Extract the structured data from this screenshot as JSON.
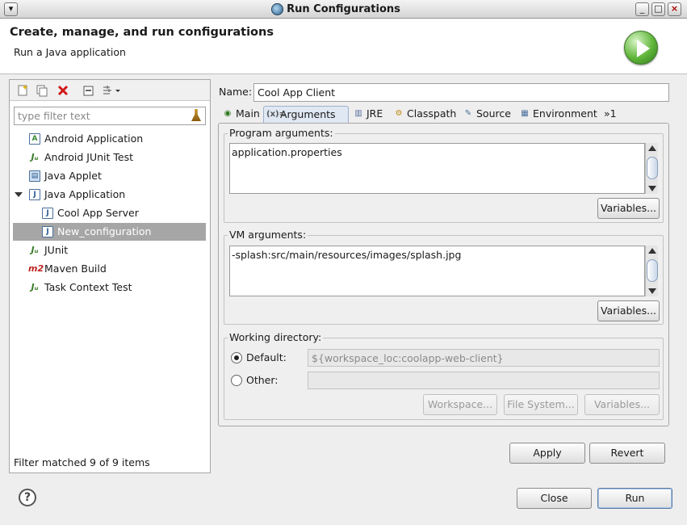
{
  "window": {
    "title": "Run Configurations",
    "menu_icon": "chevron-down-icon",
    "minimize": "_",
    "maximize": "□",
    "close": "×"
  },
  "header": {
    "title": "Create, manage, and run configurations",
    "subtitle": "Run a Java application",
    "icon": "run-icon"
  },
  "left": {
    "toolbar": [
      "new-config-icon",
      "duplicate-icon",
      "delete-icon",
      "collapse-all-icon",
      "filter-icon"
    ],
    "filter_placeholder": "type filter text",
    "tree": [
      {
        "label": "Android Application",
        "icon": "android-app-icon",
        "level": 0
      },
      {
        "label": "Android JUnit Test",
        "icon": "junit-icon",
        "level": 0
      },
      {
        "label": "Java Applet",
        "icon": "java-applet-icon",
        "level": 0
      },
      {
        "label": "Java Application",
        "icon": "java-app-icon",
        "level": 0,
        "expanded": true
      },
      {
        "label": "Cool App Server",
        "icon": "java-app-icon",
        "level": 1
      },
      {
        "label": "New_configuration",
        "icon": "java-app-icon",
        "level": 1,
        "selected": true
      },
      {
        "label": "JUnit",
        "icon": "junit-icon",
        "level": 0
      },
      {
        "label": "Maven Build",
        "icon": "maven-icon",
        "level": 0
      },
      {
        "label": "Task Context Test",
        "icon": "task-junit-icon",
        "level": 0
      }
    ],
    "filter_status": "Filter matched 9 of 9 items"
  },
  "name": {
    "label": "Name:",
    "value": "Cool App Client"
  },
  "tabs": [
    {
      "label": "Main",
      "icon": "main-tab-icon"
    },
    {
      "label": "Arguments",
      "icon": "arguments-tab-icon",
      "active": true
    },
    {
      "label": "JRE",
      "icon": "jre-tab-icon"
    },
    {
      "label": "Classpath",
      "icon": "classpath-tab-icon"
    },
    {
      "label": "Source",
      "icon": "source-tab-icon"
    },
    {
      "label": "Environment",
      "icon": "environment-tab-icon"
    },
    {
      "label": "»1",
      "icon": "more-tabs-icon"
    }
  ],
  "program_args": {
    "label": "Program arguments:",
    "value": "application.properties",
    "variables": "Variables..."
  },
  "vm_args": {
    "label": "VM arguments:",
    "value": "-splash:src/main/resources/images/splash.jpg",
    "variables": "Variables..."
  },
  "working_dir": {
    "label": "Working directory:",
    "default_label": "Default:",
    "default_value": "${workspace_loc:coolapp-web-client}",
    "default_selected": true,
    "other_label": "Other:",
    "other_value": "",
    "workspace": "Workspace...",
    "filesystem": "File System...",
    "variables": "Variables..."
  },
  "apply": "Apply",
  "revert": "Revert",
  "close": "Close",
  "run": "Run",
  "help": "?"
}
